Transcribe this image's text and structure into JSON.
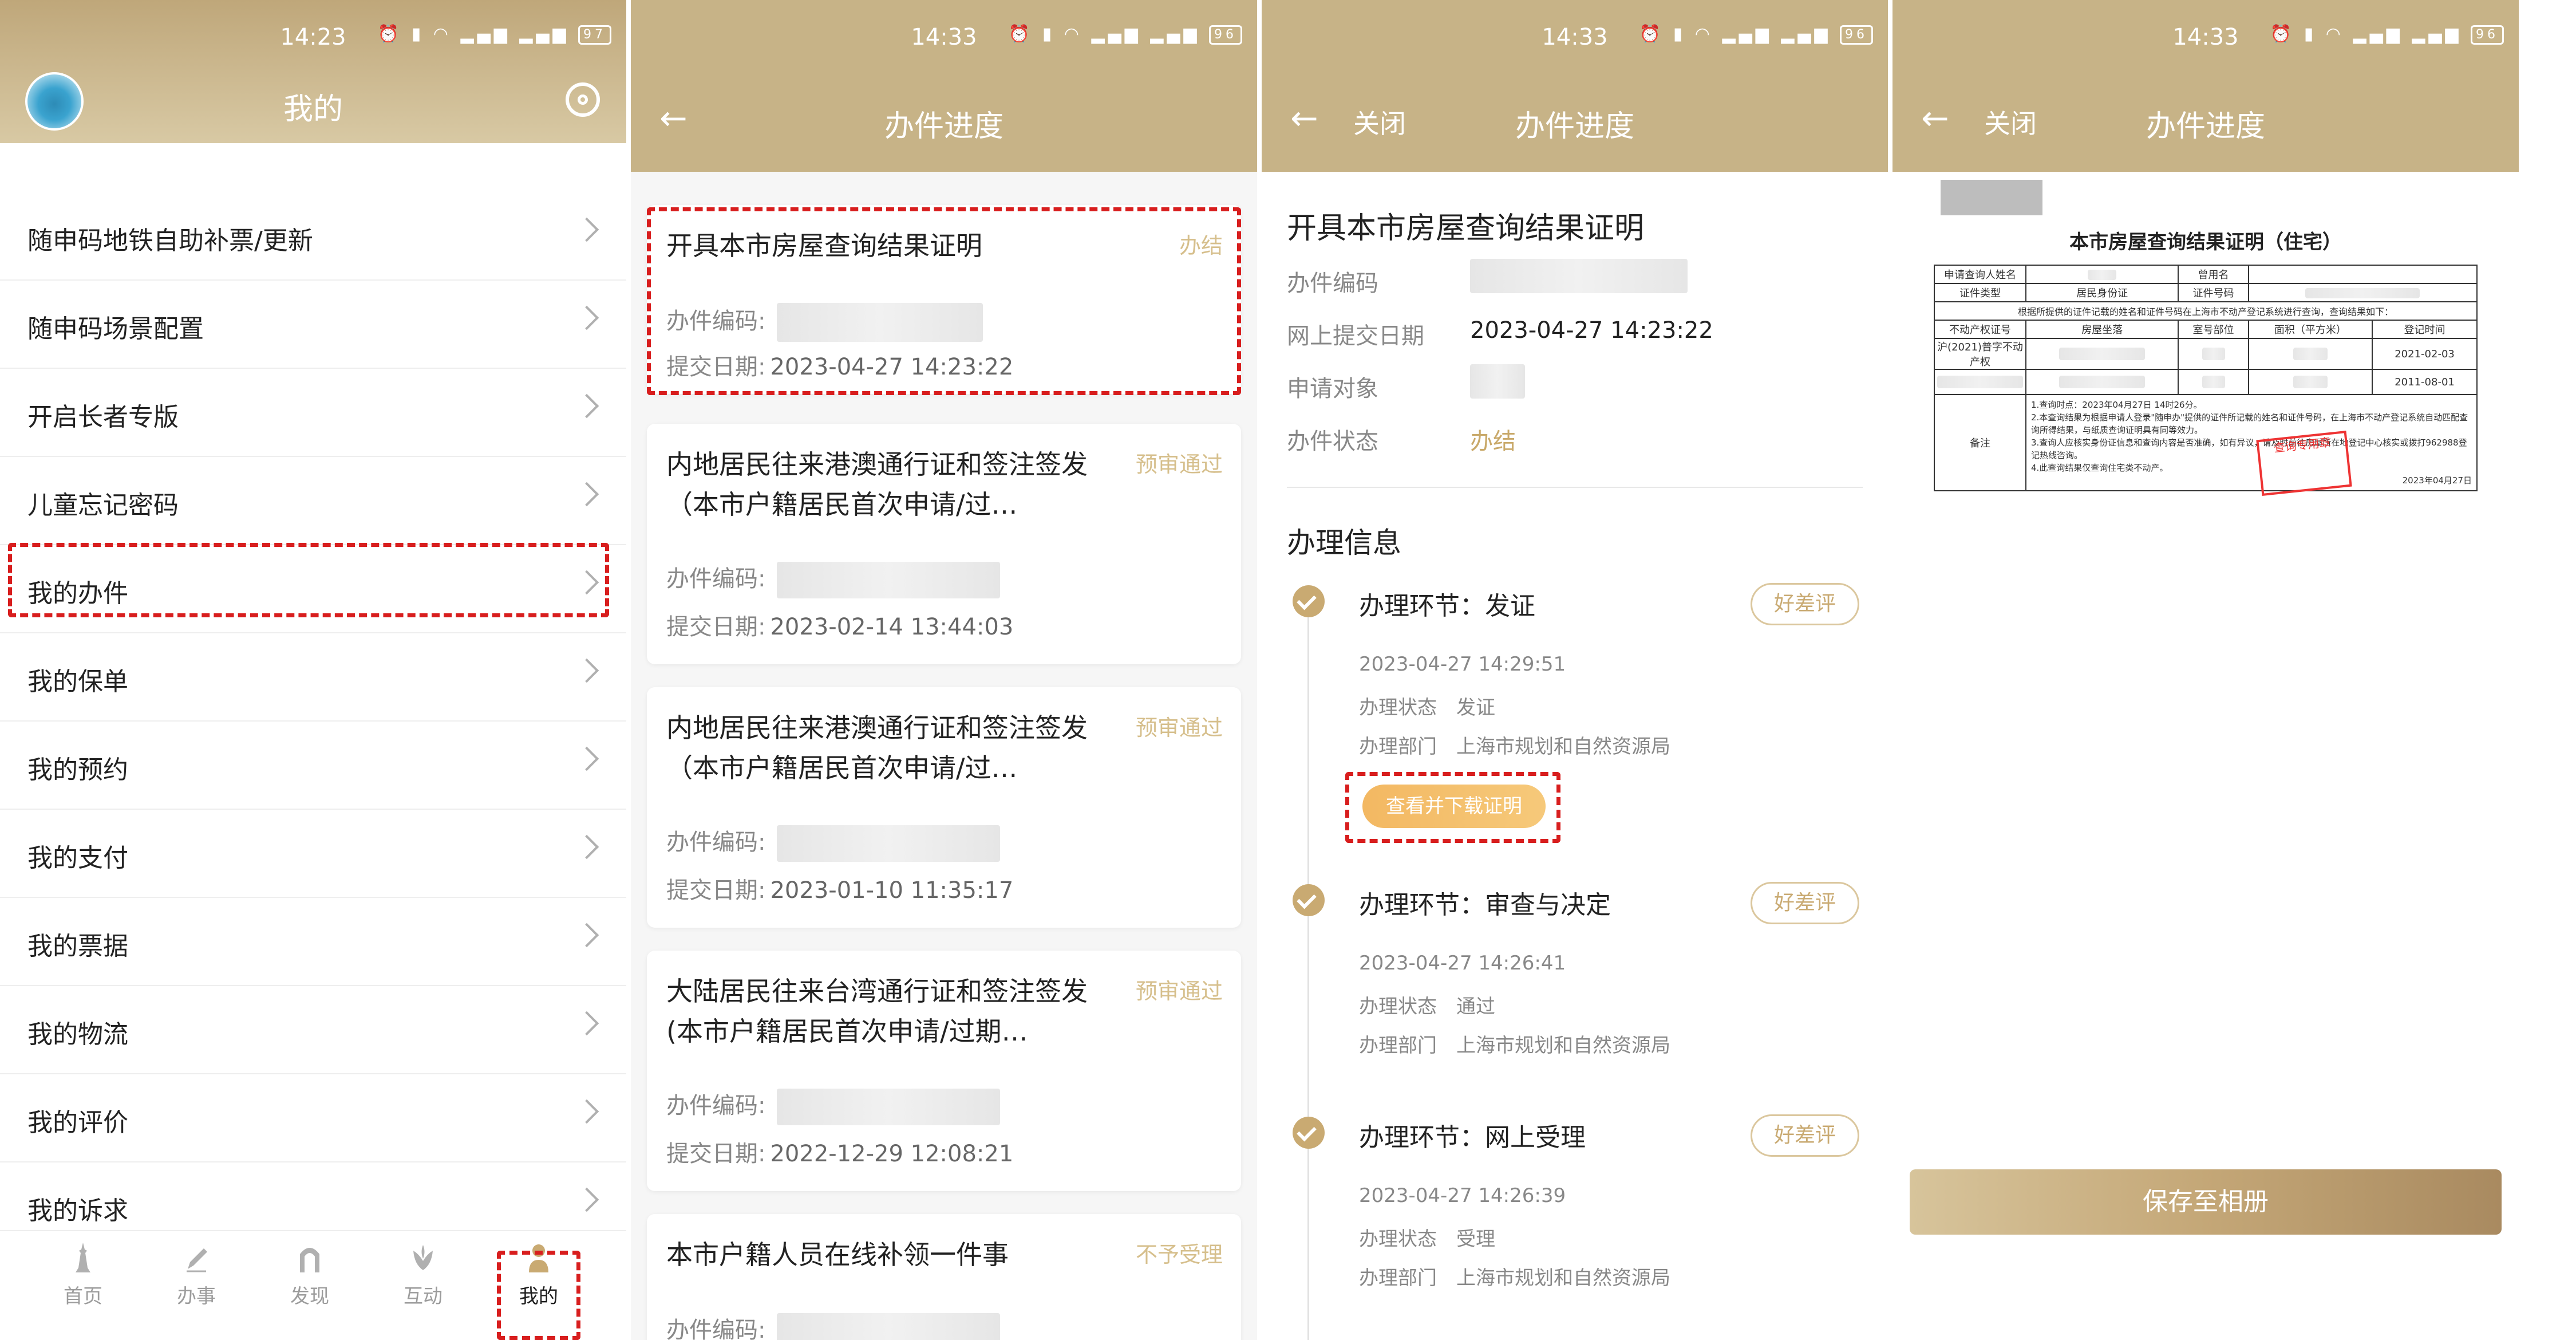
{
  "status_bars": [
    {
      "time": "14:23",
      "battery": "97"
    },
    {
      "time": "14:33",
      "battery": "96"
    },
    {
      "time": "14:33",
      "battery": "96"
    },
    {
      "time": "14:33",
      "battery": "96"
    }
  ],
  "mine": {
    "title": "我的",
    "menu": [
      {
        "label": "随申码地铁自助补票/更新"
      },
      {
        "label": "随申码场景配置"
      },
      {
        "label": "开启长者专版"
      },
      {
        "label": "儿童忘记密码"
      },
      {
        "label": "我的办件"
      },
      {
        "label": "我的保单"
      },
      {
        "label": "我的预约"
      },
      {
        "label": "我的支付"
      },
      {
        "label": "我的票据"
      },
      {
        "label": "我的物流"
      },
      {
        "label": "我的评价"
      },
      {
        "label": "我的诉求"
      }
    ],
    "tabs": [
      {
        "label": "首页"
      },
      {
        "label": "办事"
      },
      {
        "label": "发现"
      },
      {
        "label": "互动"
      },
      {
        "label": "我的"
      }
    ]
  },
  "progress_list": {
    "title": "办件进度",
    "code_label": "办件编码:",
    "date_label": "提交日期:",
    "cards": [
      {
        "title": "开具本市房屋查询结果证明",
        "status": "办结",
        "date": "2023-04-27 14:23:22"
      },
      {
        "title": "内地居民往来港澳通行证和签注签发（本市户籍居民首次申请/过…",
        "status": "预审通过",
        "date": "2023-02-14 13:44:03"
      },
      {
        "title": "内地居民往来港澳通行证和签注签发（本市户籍居民首次申请/过…",
        "status": "预审通过",
        "date": "2023-01-10 11:35:17"
      },
      {
        "title": "大陆居民往来台湾通行证和签注签发(本市户籍居民首次申请/过期…",
        "status": "预审通过",
        "date": "2022-12-29 12:08:21"
      },
      {
        "title": "本市户籍人员在线补领一件事",
        "status": "不予受理",
        "date": ""
      }
    ]
  },
  "detail": {
    "close": "关闭",
    "title": "办件进度",
    "item_title": "开具本市房屋查询结果证明",
    "rows": {
      "code_label": "办件编码",
      "submit_label": "网上提交日期",
      "submit_value": "2023-04-27 14:23:22",
      "target_label": "申请对象",
      "status_label": "办件状态",
      "status_value": "办结"
    },
    "section_title": "办理信息",
    "rate_label": "好差评",
    "download_label": "查看并下载证明",
    "status_label": "办理状态",
    "dept_label": "办理部门",
    "steps": [
      {
        "title": "办理环节：发证",
        "time": "2023-04-27 14:29:51",
        "status": "发证",
        "dept": "上海市规划和自然资源局"
      },
      {
        "title": "办理环节：审查与决定",
        "time": "2023-04-27 14:26:41",
        "status": "通过",
        "dept": "上海市规划和自然资源局"
      },
      {
        "title": "办理环节：网上受理",
        "time": "2023-04-27 14:26:39",
        "status": "受理",
        "dept": "上海市规划和自然资源局"
      }
    ]
  },
  "certificate": {
    "close": "关闭",
    "title": "办件进度",
    "doc_title": "本市房屋查询结果证明（住宅）",
    "row1": [
      "申请查询人姓名",
      "",
      "曾用名",
      ""
    ],
    "row2": [
      "证件类型",
      "居民身份证",
      "证件号码",
      ""
    ],
    "row3": "根据所提供的证件记载的姓名和证件号码在上海市不动产登记系统进行查询，查询结果如下：",
    "headers": [
      "不动产权证号",
      "房屋坐落",
      "室号部位",
      "面积（平方米）",
      "登记时间"
    ],
    "records": [
      {
        "cert_no": "沪(2021)普字不动产权",
        "date": "2021-02-03"
      },
      {
        "cert_no": "",
        "date": "2011-08-01"
      }
    ],
    "notes_label": "备注",
    "notes": [
      "1.查询时点：2023年04月27日 14时26分。",
      "2.本查询结果为根据申请人登录\"随申办\"提供的证件所记载的姓名和证件号码，在上海市不动产登记系统自动匹配查询所得结果，与纸质查询证明具有同等效力。",
      "3.查询人应核实身份证信息和查询内容是否准确，如有异议，请及时前往房屋所在地登记中心核实或拨打962988登记热线咨询。",
      "4.此查询结果仅查询住宅类不动产。"
    ],
    "issue_date": "2023年04月27日",
    "stamp": "查询专用章",
    "save_label": "保存至相册"
  }
}
